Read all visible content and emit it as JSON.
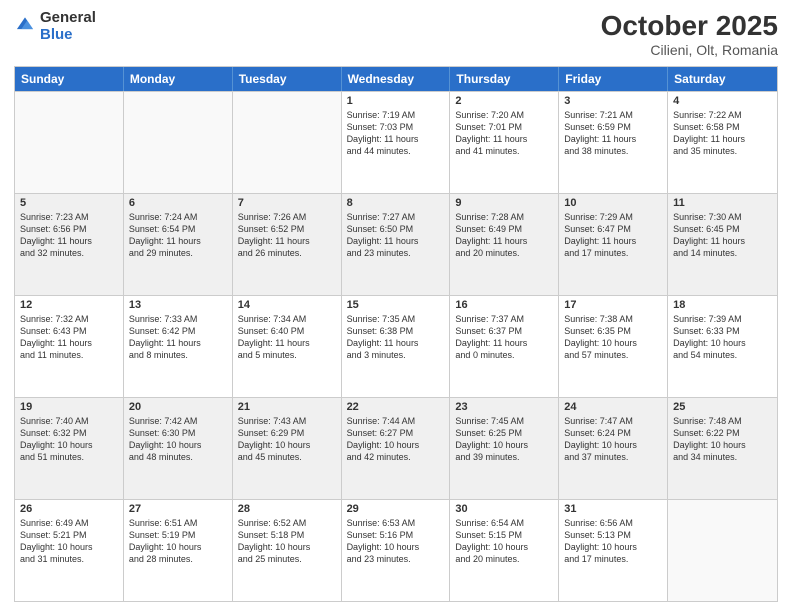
{
  "header": {
    "logo_general": "General",
    "logo_blue": "Blue",
    "title": "October 2025",
    "location": "Cilieni, Olt, Romania"
  },
  "days_of_week": [
    "Sunday",
    "Monday",
    "Tuesday",
    "Wednesday",
    "Thursday",
    "Friday",
    "Saturday"
  ],
  "weeks": [
    [
      {
        "day": "",
        "text": "",
        "empty": true
      },
      {
        "day": "",
        "text": "",
        "empty": true
      },
      {
        "day": "",
        "text": "",
        "empty": true
      },
      {
        "day": "1",
        "text": "Sunrise: 7:19 AM\nSunset: 7:03 PM\nDaylight: 11 hours\nand 44 minutes.",
        "empty": false
      },
      {
        "day": "2",
        "text": "Sunrise: 7:20 AM\nSunset: 7:01 PM\nDaylight: 11 hours\nand 41 minutes.",
        "empty": false
      },
      {
        "day": "3",
        "text": "Sunrise: 7:21 AM\nSunset: 6:59 PM\nDaylight: 11 hours\nand 38 minutes.",
        "empty": false
      },
      {
        "day": "4",
        "text": "Sunrise: 7:22 AM\nSunset: 6:58 PM\nDaylight: 11 hours\nand 35 minutes.",
        "empty": false
      }
    ],
    [
      {
        "day": "5",
        "text": "Sunrise: 7:23 AM\nSunset: 6:56 PM\nDaylight: 11 hours\nand 32 minutes.",
        "empty": false
      },
      {
        "day": "6",
        "text": "Sunrise: 7:24 AM\nSunset: 6:54 PM\nDaylight: 11 hours\nand 29 minutes.",
        "empty": false
      },
      {
        "day": "7",
        "text": "Sunrise: 7:26 AM\nSunset: 6:52 PM\nDaylight: 11 hours\nand 26 minutes.",
        "empty": false
      },
      {
        "day": "8",
        "text": "Sunrise: 7:27 AM\nSunset: 6:50 PM\nDaylight: 11 hours\nand 23 minutes.",
        "empty": false
      },
      {
        "day": "9",
        "text": "Sunrise: 7:28 AM\nSunset: 6:49 PM\nDaylight: 11 hours\nand 20 minutes.",
        "empty": false
      },
      {
        "day": "10",
        "text": "Sunrise: 7:29 AM\nSunset: 6:47 PM\nDaylight: 11 hours\nand 17 minutes.",
        "empty": false
      },
      {
        "day": "11",
        "text": "Sunrise: 7:30 AM\nSunset: 6:45 PM\nDaylight: 11 hours\nand 14 minutes.",
        "empty": false
      }
    ],
    [
      {
        "day": "12",
        "text": "Sunrise: 7:32 AM\nSunset: 6:43 PM\nDaylight: 11 hours\nand 11 minutes.",
        "empty": false
      },
      {
        "day": "13",
        "text": "Sunrise: 7:33 AM\nSunset: 6:42 PM\nDaylight: 11 hours\nand 8 minutes.",
        "empty": false
      },
      {
        "day": "14",
        "text": "Sunrise: 7:34 AM\nSunset: 6:40 PM\nDaylight: 11 hours\nand 5 minutes.",
        "empty": false
      },
      {
        "day": "15",
        "text": "Sunrise: 7:35 AM\nSunset: 6:38 PM\nDaylight: 11 hours\nand 3 minutes.",
        "empty": false
      },
      {
        "day": "16",
        "text": "Sunrise: 7:37 AM\nSunset: 6:37 PM\nDaylight: 11 hours\nand 0 minutes.",
        "empty": false
      },
      {
        "day": "17",
        "text": "Sunrise: 7:38 AM\nSunset: 6:35 PM\nDaylight: 10 hours\nand 57 minutes.",
        "empty": false
      },
      {
        "day": "18",
        "text": "Sunrise: 7:39 AM\nSunset: 6:33 PM\nDaylight: 10 hours\nand 54 minutes.",
        "empty": false
      }
    ],
    [
      {
        "day": "19",
        "text": "Sunrise: 7:40 AM\nSunset: 6:32 PM\nDaylight: 10 hours\nand 51 minutes.",
        "empty": false
      },
      {
        "day": "20",
        "text": "Sunrise: 7:42 AM\nSunset: 6:30 PM\nDaylight: 10 hours\nand 48 minutes.",
        "empty": false
      },
      {
        "day": "21",
        "text": "Sunrise: 7:43 AM\nSunset: 6:29 PM\nDaylight: 10 hours\nand 45 minutes.",
        "empty": false
      },
      {
        "day": "22",
        "text": "Sunrise: 7:44 AM\nSunset: 6:27 PM\nDaylight: 10 hours\nand 42 minutes.",
        "empty": false
      },
      {
        "day": "23",
        "text": "Sunrise: 7:45 AM\nSunset: 6:25 PM\nDaylight: 10 hours\nand 39 minutes.",
        "empty": false
      },
      {
        "day": "24",
        "text": "Sunrise: 7:47 AM\nSunset: 6:24 PM\nDaylight: 10 hours\nand 37 minutes.",
        "empty": false
      },
      {
        "day": "25",
        "text": "Sunrise: 7:48 AM\nSunset: 6:22 PM\nDaylight: 10 hours\nand 34 minutes.",
        "empty": false
      }
    ],
    [
      {
        "day": "26",
        "text": "Sunrise: 6:49 AM\nSunset: 5:21 PM\nDaylight: 10 hours\nand 31 minutes.",
        "empty": false
      },
      {
        "day": "27",
        "text": "Sunrise: 6:51 AM\nSunset: 5:19 PM\nDaylight: 10 hours\nand 28 minutes.",
        "empty": false
      },
      {
        "day": "28",
        "text": "Sunrise: 6:52 AM\nSunset: 5:18 PM\nDaylight: 10 hours\nand 25 minutes.",
        "empty": false
      },
      {
        "day": "29",
        "text": "Sunrise: 6:53 AM\nSunset: 5:16 PM\nDaylight: 10 hours\nand 23 minutes.",
        "empty": false
      },
      {
        "day": "30",
        "text": "Sunrise: 6:54 AM\nSunset: 5:15 PM\nDaylight: 10 hours\nand 20 minutes.",
        "empty": false
      },
      {
        "day": "31",
        "text": "Sunrise: 6:56 AM\nSunset: 5:13 PM\nDaylight: 10 hours\nand 17 minutes.",
        "empty": false
      },
      {
        "day": "",
        "text": "",
        "empty": true
      }
    ]
  ]
}
